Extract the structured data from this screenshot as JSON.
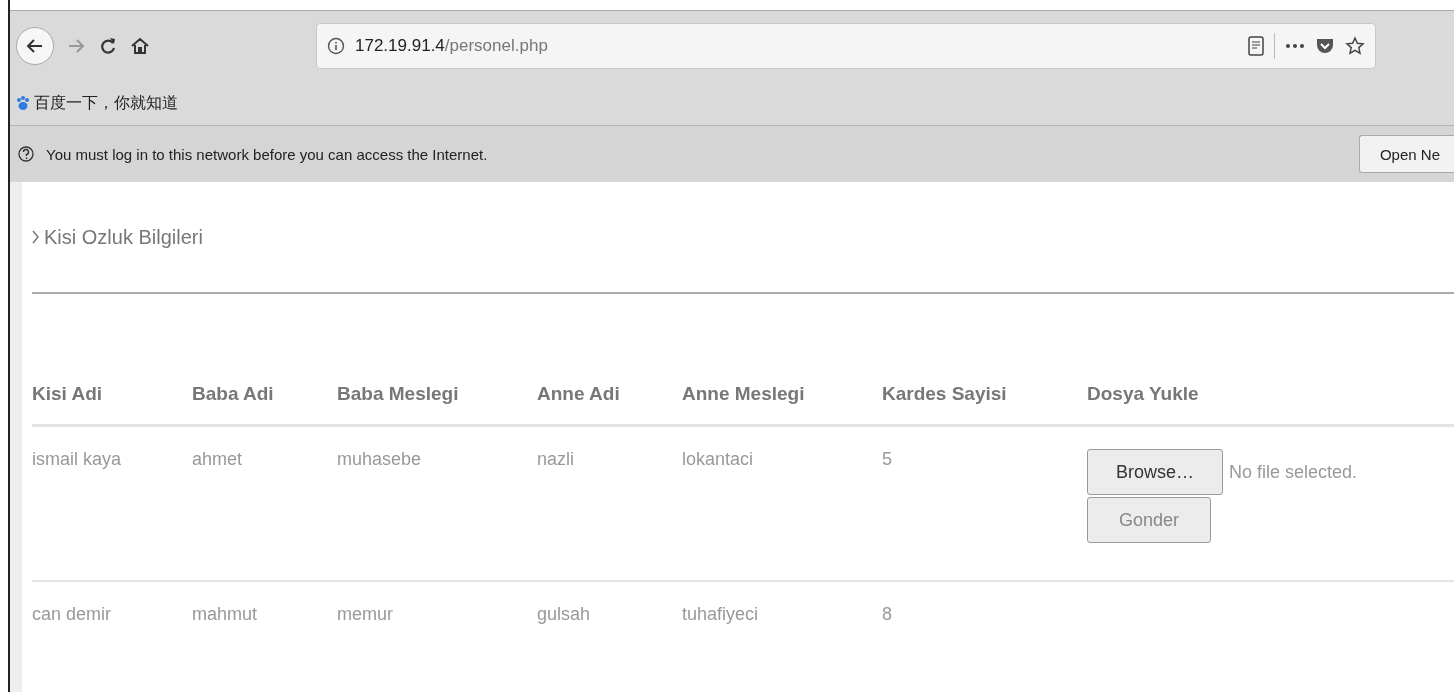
{
  "address_bar": {
    "host": "172.19.91.4",
    "path": "/personel.php"
  },
  "bookmarks": [
    {
      "label": "百度一下，你就知道"
    }
  ],
  "notification": {
    "message": "You must log in to this network before you can access the Internet.",
    "button": "Open Ne"
  },
  "page": {
    "breadcrumb": "Kisi Ozluk Bilgileri",
    "table": {
      "columns": [
        "Kisi Adi",
        "Baba Adi",
        "Baba Meslegi",
        "Anne Adi",
        "Anne Meslegi",
        "Kardes Sayisi",
        "Dosya Yukle"
      ],
      "rows": [
        {
          "cells": [
            "ismail kaya",
            "ahmet",
            "muhasebe",
            "nazli",
            "lokantaci",
            "5"
          ],
          "upload": {
            "browse": "Browse…",
            "status": "No file selected.",
            "submit": "Gonder"
          }
        },
        {
          "cells": [
            "can demir",
            "mahmut",
            "memur",
            "gulsah",
            "tuhafiyeci",
            "8"
          ]
        }
      ]
    }
  }
}
